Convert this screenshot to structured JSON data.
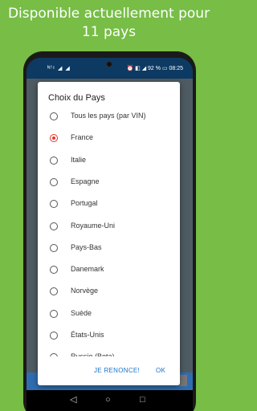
{
  "headline": {
    "line1": "Disponible actuellement pour",
    "line2": "11 pays"
  },
  "status_bar": {
    "left": "ᴺᶠᶜ ◢ ◢",
    "right": "⏰ ◧ ◢ 92 % ▭ 08:25"
  },
  "dialog": {
    "title": "Choix du Pays",
    "options": [
      {
        "label": "Tous les pays (par VIN)",
        "checked": false
      },
      {
        "label": "France",
        "checked": true
      },
      {
        "label": "Italie",
        "checked": false
      },
      {
        "label": "Espagne",
        "checked": false
      },
      {
        "label": "Portugal",
        "checked": false
      },
      {
        "label": "Royaume-Uni",
        "checked": false
      },
      {
        "label": "Pays-Bas",
        "checked": false
      },
      {
        "label": "Danemark",
        "checked": false
      },
      {
        "label": "Norvège",
        "checked": false
      },
      {
        "label": "Suède",
        "checked": false
      },
      {
        "label": "États-Unis",
        "checked": false
      },
      {
        "label": "Russie (Beta)",
        "checked": false
      }
    ],
    "cancel_label": "JE RENONCE!",
    "ok_label": "OK"
  },
  "nav": {
    "back": "◁",
    "home": "○",
    "recents": "□"
  },
  "colors": {
    "background": "#77bd46",
    "accent": "#e8372a",
    "button": "#1a73c8"
  }
}
